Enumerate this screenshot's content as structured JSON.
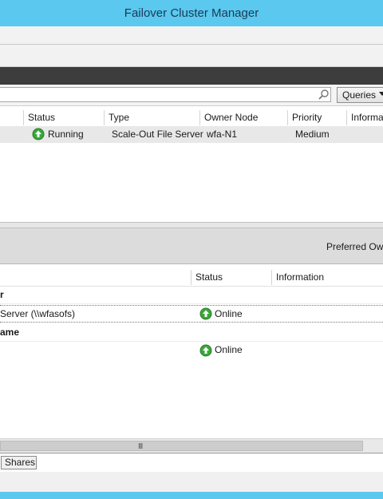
{
  "window": {
    "title": "Failover Cluster Manager"
  },
  "search": {
    "placeholder": "",
    "queries_label": "Queries"
  },
  "roles_grid": {
    "columns": [
      "Status",
      "Type",
      "Owner Node",
      "Priority",
      "Informati"
    ],
    "rows": [
      {
        "status": "Running",
        "type": "Scale-Out File Server",
        "owner_node": "wfa-N1",
        "priority": "Medium",
        "information": ""
      }
    ]
  },
  "summary": {
    "preferred_owners": "Preferred Owne"
  },
  "resources_grid": {
    "columns": [
      "Status",
      "Information"
    ],
    "groups": [
      {
        "title": "r",
        "items": [
          {
            "name": "Server (\\\\wfasofs)",
            "status": "Online"
          }
        ]
      },
      {
        "title": "ame",
        "items": [
          {
            "name": "",
            "status": "Online"
          }
        ]
      }
    ]
  },
  "scrollbar": {
    "grip": "III"
  },
  "tabs": [
    {
      "label": "Shares"
    }
  ],
  "colors": {
    "title_bar": "#5bc8ef",
    "status_ok": "#3aa63a",
    "dark_bar": "#3d3d3d"
  },
  "icons": {
    "status_up": "green-up-arrow-icon",
    "search": "search-icon",
    "dropdown": "chevron-down-icon"
  }
}
